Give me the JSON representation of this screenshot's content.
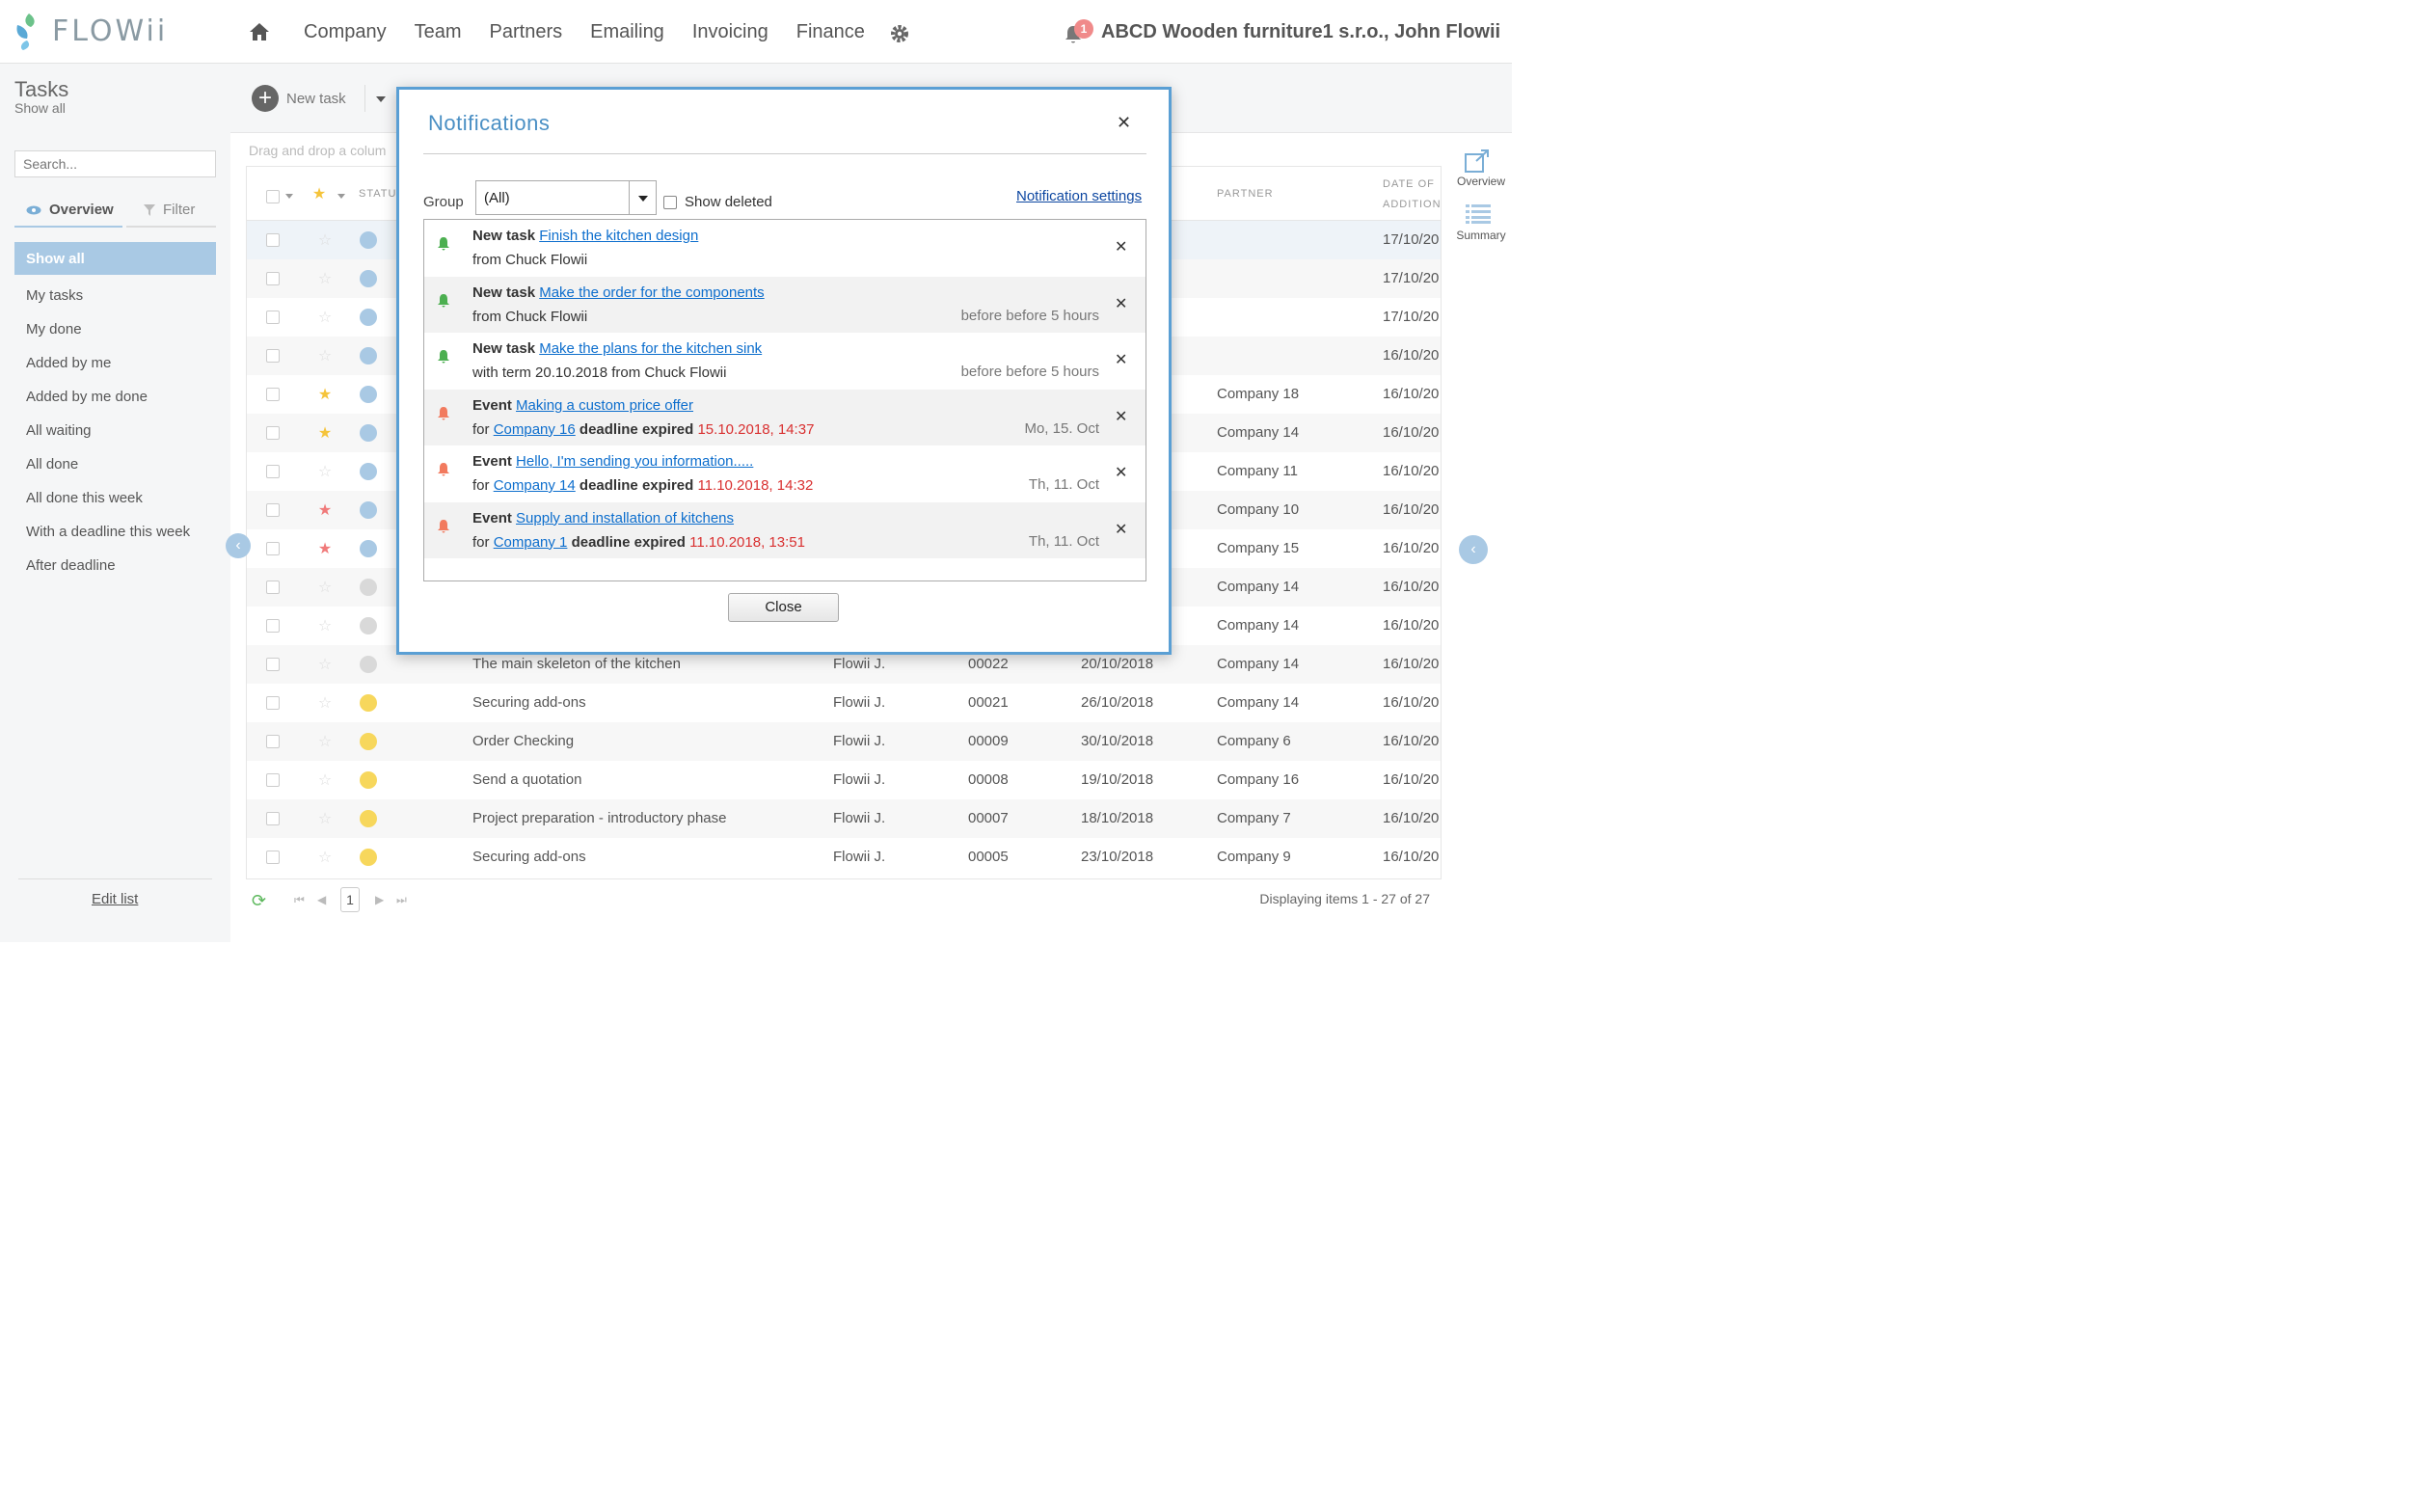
{
  "header": {
    "logo": "FLOWii",
    "nav": [
      "Company",
      "Team",
      "Partners",
      "Emailing",
      "Invoicing",
      "Finance"
    ],
    "notification_count": "1",
    "company_user": "ABCD Wooden furniture1 s.r.o., John Flowii"
  },
  "sidebar": {
    "title": "Tasks",
    "subtitle": "Show all",
    "search_placeholder": "Search...",
    "tab_overview": "Overview",
    "tab_filter": "Filter",
    "items": [
      "Show all",
      "My tasks",
      "My done",
      "Added by me",
      "Added by me done",
      "All waiting",
      "All done",
      "All done this week",
      "With a deadline this week",
      "After deadline"
    ],
    "edit_list": "Edit list"
  },
  "toolbar": {
    "new_task": "New task",
    "drag_hint": "Drag and drop a colum"
  },
  "grid": {
    "headers": {
      "status": "STATU",
      "partner": "PARTNER",
      "date_line1": "DATE OF",
      "date_line2": "ADDITION"
    },
    "rows": [
      {
        "star": "off",
        "status": "wait",
        "title": "",
        "owner": "",
        "code": "",
        "deadline": "",
        "partner": "",
        "added": "17/10/20"
      },
      {
        "star": "off",
        "status": "wait",
        "title": "",
        "owner": "",
        "code": "",
        "deadline": "",
        "partner": "",
        "added": "17/10/20"
      },
      {
        "star": "off",
        "status": "wait",
        "title": "",
        "owner": "",
        "code": "",
        "deadline": "",
        "partner": "",
        "added": "17/10/20"
      },
      {
        "star": "off",
        "status": "wait",
        "title": "",
        "owner": "",
        "code": "",
        "deadline": "",
        "partner": "",
        "added": "16/10/20"
      },
      {
        "star": "on",
        "status": "wait",
        "title": "",
        "owner": "",
        "code": "",
        "deadline": "",
        "partner": "Company 18",
        "added": "16/10/20"
      },
      {
        "star": "on",
        "status": "wait",
        "title": "",
        "owner": "",
        "code": "",
        "deadline": "",
        "partner": "Company 14",
        "added": "16/10/20"
      },
      {
        "star": "off",
        "status": "wait",
        "title": "",
        "owner": "",
        "code": "",
        "deadline": "",
        "partner": "Company 11",
        "added": "16/10/20"
      },
      {
        "star": "red",
        "status": "wait",
        "title": "",
        "owner": "",
        "code": "",
        "deadline": "",
        "partner": "Company 10",
        "added": "16/10/20"
      },
      {
        "star": "red",
        "status": "wait",
        "title": "",
        "owner": "",
        "code": "",
        "deadline": "",
        "partner": "Company 15",
        "added": "16/10/20"
      },
      {
        "star": "off",
        "status": "done",
        "title": "",
        "owner": "",
        "code": "",
        "deadline": "",
        "partner": "Company 14",
        "added": "16/10/20"
      },
      {
        "star": "off",
        "status": "done",
        "title": "",
        "owner": "",
        "code": "",
        "deadline": "",
        "partner": "Company 14",
        "added": "16/10/20"
      },
      {
        "star": "off",
        "status": "done",
        "title": "The main skeleton of the kitchen",
        "owner": "Flowii J.",
        "code": "00022",
        "deadline": "20/10/2018",
        "partner": "Company 14",
        "added": "16/10/20"
      },
      {
        "star": "off",
        "status": "play",
        "title": "Securing add-ons",
        "owner": "Flowii J.",
        "code": "00021",
        "deadline": "26/10/2018",
        "partner": "Company 14",
        "added": "16/10/20"
      },
      {
        "star": "off",
        "status": "play",
        "title": "Order Checking",
        "owner": "Flowii J.",
        "code": "00009",
        "deadline": "30/10/2018",
        "partner": "Company 6",
        "added": "16/10/20"
      },
      {
        "star": "off",
        "status": "play",
        "title": "Send a quotation",
        "owner": "Flowii J.",
        "code": "00008",
        "deadline": "19/10/2018",
        "partner": "Company 16",
        "added": "16/10/20"
      },
      {
        "star": "off",
        "status": "play",
        "title": "Project preparation - introductory phase",
        "owner": "Flowii J.",
        "code": "00007",
        "deadline": "18/10/2018",
        "partner": "Company 7",
        "added": "16/10/20"
      },
      {
        "star": "off",
        "status": "play",
        "title": "Securing add-ons",
        "owner": "Flowii J.",
        "code": "00005",
        "deadline": "23/10/2018",
        "partner": "Company 9",
        "added": "16/10/20"
      }
    ],
    "page": "1",
    "display_info": "Displaying items 1 - 27 of 27"
  },
  "rightbar": {
    "overview": "Overview",
    "summary": "Summary"
  },
  "modal": {
    "title": "Notifications",
    "group_label": "Group",
    "group_value": "(All)",
    "show_deleted": "Show deleted",
    "settings_link": "Notification settings",
    "close_label": "Close",
    "items": [
      {
        "color": "#4caf50",
        "kind": "New task",
        "link": "Finish the kitchen design",
        "pre": "from Chuck Flowii",
        "entity": "",
        "mid": "",
        "date": "",
        "when": ""
      },
      {
        "color": "#4caf50",
        "kind": "New task",
        "link": "Make the order for the components",
        "pre": "from Chuck Flowii",
        "entity": "",
        "mid": "",
        "date": "",
        "when": "before before 5 hours"
      },
      {
        "color": "#4caf50",
        "kind": "New task",
        "link": "Make the plans for the kitchen sink",
        "pre": "with term 20.10.2018 from Chuck Flowii",
        "entity": "",
        "mid": "",
        "date": "",
        "when": "before before 5 hours"
      },
      {
        "color": "#f27a5e",
        "kind": "Event",
        "link": "Making a custom price offer",
        "pre": "for",
        "entity": "Company 16",
        "mid": "deadline expired",
        "date": "15.10.2018, 14:37",
        "when": "Mo, 15. Oct"
      },
      {
        "color": "#f27a5e",
        "kind": "Event",
        "link": "Hello, I'm sending you information.....",
        "pre": "for",
        "entity": "Company 14",
        "mid": "deadline expired",
        "date": "11.10.2018, 14:32",
        "when": "Th, 11. Oct"
      },
      {
        "color": "#f27a5e",
        "kind": "Event",
        "link": "Supply and installation of kitchens",
        "pre": "for",
        "entity": "Company 1",
        "mid": "deadline expired",
        "date": "11.10.2018, 13:51",
        "when": "Th, 11. Oct"
      }
    ]
  }
}
